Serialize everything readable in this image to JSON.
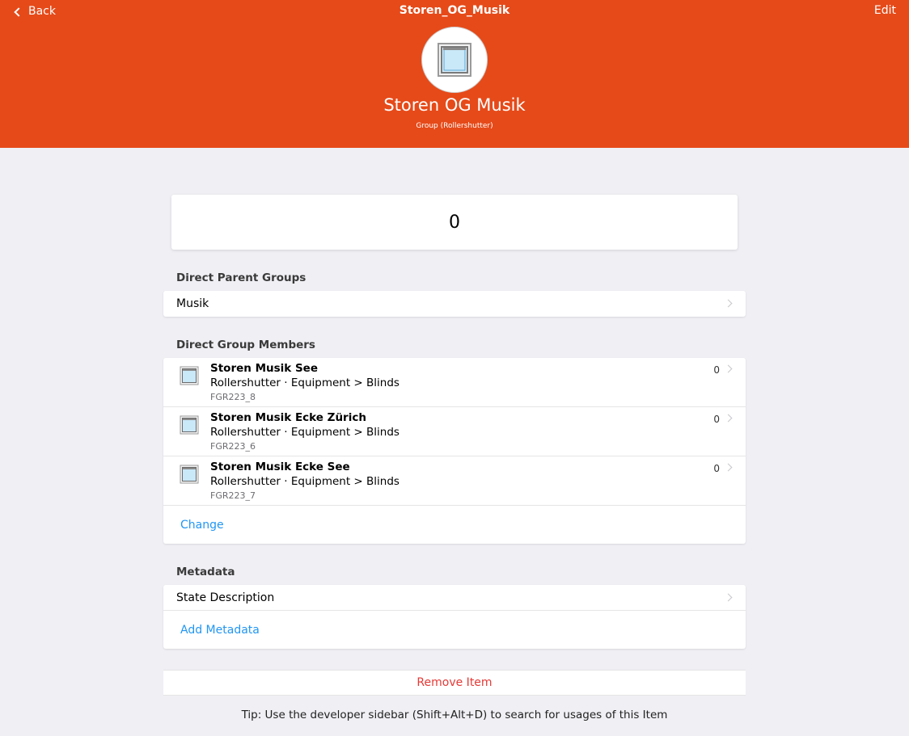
{
  "navbar": {
    "back_label": "Back",
    "title": "Storen_OG_Musik",
    "edit_label": "Edit"
  },
  "item": {
    "label": "Storen OG Musik",
    "type": "Group (Rollershutter)",
    "icon": "window-blind-icon",
    "state": "0"
  },
  "colors": {
    "header": "#e64a19",
    "link": "#2196f3",
    "danger": "#e53935"
  },
  "parents": {
    "title": "Direct Parent Groups",
    "items": [
      {
        "label": "Musik"
      }
    ]
  },
  "members": {
    "title": "Direct Group Members",
    "items": [
      {
        "label": "Storen Musik See",
        "type": "Rollershutter · Equipment > Blinds",
        "name": "FGR223_8",
        "state": "0"
      },
      {
        "label": "Storen Musik Ecke Zürich",
        "type": "Rollershutter · Equipment > Blinds",
        "name": "FGR223_6",
        "state": "0"
      },
      {
        "label": "Storen Musik Ecke See",
        "type": "Rollershutter · Equipment > Blinds",
        "name": "FGR223_7",
        "state": "0"
      }
    ],
    "change_label": "Change"
  },
  "metadata": {
    "title": "Metadata",
    "items": [
      {
        "label": "State Description"
      }
    ],
    "add_label": "Add Metadata"
  },
  "remove_label": "Remove Item",
  "tip": "Tip: Use the developer sidebar (Shift+Alt+D) to search for usages of this Item"
}
